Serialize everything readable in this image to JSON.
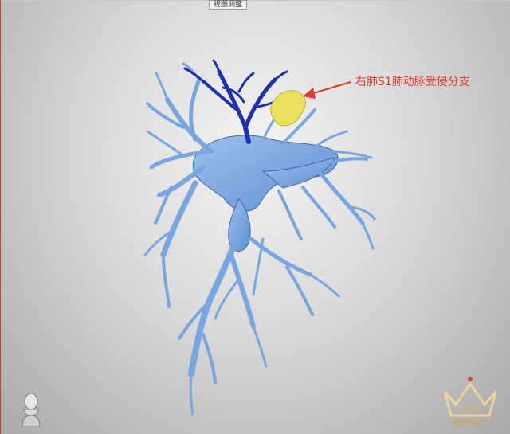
{
  "toolbar": {
    "view_adjust_label": "视图调整"
  },
  "annotation": {
    "text": "右肺S1肺动脉受侵分支",
    "color": "#e53a2a"
  },
  "model": {
    "vessel_color": "#7aa6e0",
    "vessel_edge_color": "#4d79b8",
    "invaded_branch_color": "#1f2fb0",
    "tumor_color": "#e9e25a"
  },
  "logo": {
    "text": "紫薇帝星",
    "badge": "ZWDX",
    "icon": "crown-icon"
  },
  "orientation_widget": {
    "icon": "head-orientation-icon"
  }
}
